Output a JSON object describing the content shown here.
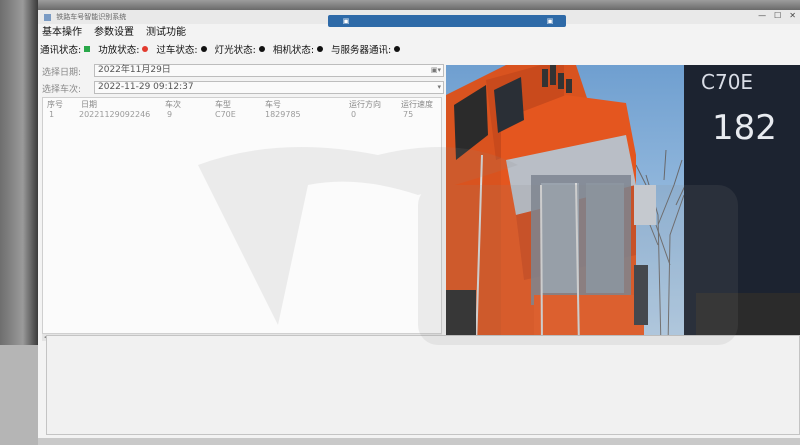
{
  "window": {
    "title": "铁路车号智能识别系统"
  },
  "menu": [
    "基本操作",
    "参数设置",
    "测试功能"
  ],
  "status": {
    "comm_label": "通讯状态:",
    "items": [
      {
        "label": "功放状态:",
        "color": "#e23b2e"
      },
      {
        "label": "过车状态:",
        "color": "#111111"
      },
      {
        "label": "灯光状态:",
        "color": "#111111"
      },
      {
        "label": "相机状态:",
        "color": "#111111"
      },
      {
        "label": "与服务器通讯:",
        "color": "#111111"
      }
    ],
    "comm_color": "#2aa84a"
  },
  "form": {
    "date_label": "选择日期:",
    "date_value": "2022年11月29日",
    "train_label": "选择车次:",
    "train_value": "2022-11-29 09:12:37"
  },
  "table": {
    "headers": [
      "序号",
      "日期",
      "车次",
      "车型",
      "车号",
      "运行方向",
      "运行速度"
    ],
    "rows": [
      [
        "1",
        "20221129092246",
        "9",
        "C70E",
        "1829785",
        "0",
        "75"
      ]
    ]
  },
  "camera": {
    "car_type_text": "C70E",
    "car_number_text": "182"
  },
  "colors": {
    "accent": "#2e6aa8",
    "locomotive_orange": "#e8541f",
    "sky": "#8fb5d8"
  }
}
